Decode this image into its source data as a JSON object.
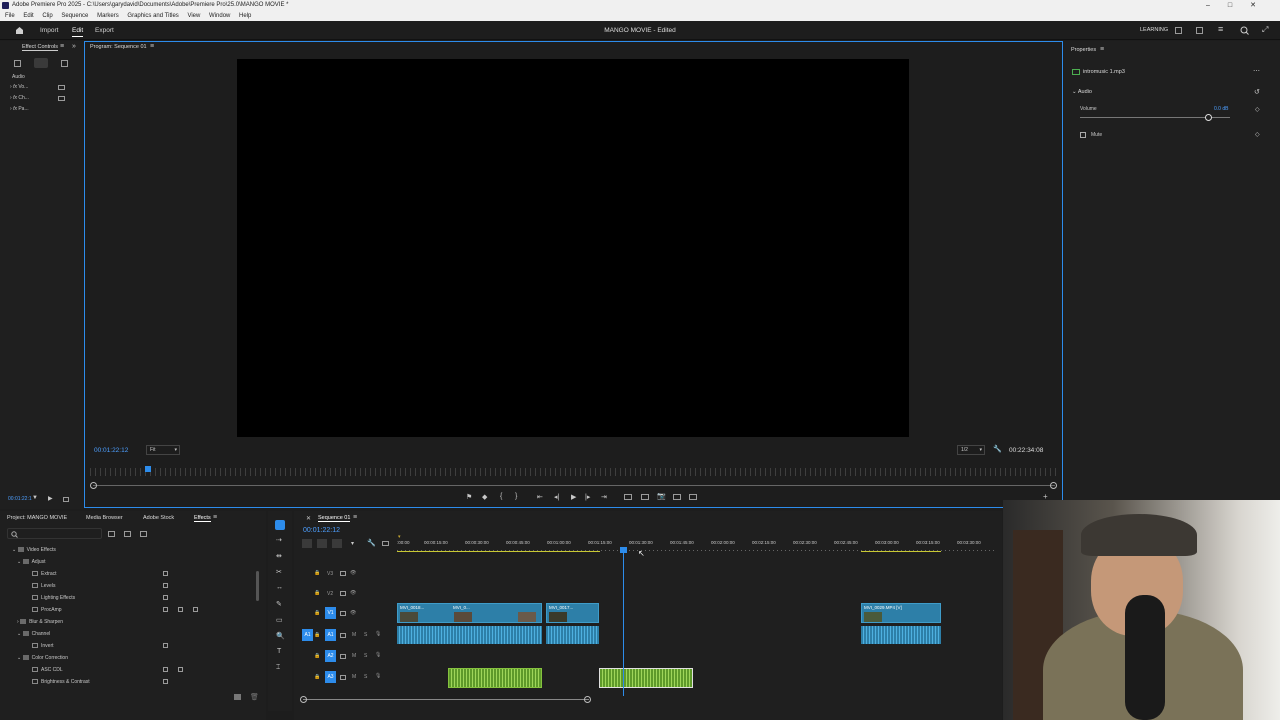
{
  "window": {
    "title": "Adobe Premiere Pro 2025 - C:\\Users\\garydavid\\Documents\\Adobe\\Premiere Pro\\25.0\\MANGO MOVIE *"
  },
  "menu": [
    "File",
    "Edit",
    "Clip",
    "Sequence",
    "Markers",
    "Graphics and Titles",
    "View",
    "Window",
    "Help"
  ],
  "header": {
    "tabs": [
      "Import",
      "Edit",
      "Export"
    ],
    "active_tab": "Edit",
    "project_title": "MANGO MOVIE - Edited",
    "workspace": "LEARNING"
  },
  "effect_controls": {
    "title": "Effect Controls",
    "section": "Audio",
    "rows": [
      "Vo...",
      "Ch...",
      "Pa..."
    ],
    "timecode": "00:01:22:1"
  },
  "program_monitor": {
    "title": "Program: Sequence 01",
    "timecode": "00:01:22:12",
    "fit": "Fit",
    "resolution": "1/2",
    "duration": "00:22:34:08"
  },
  "properties": {
    "title": "Properties",
    "clip_name": "intromusic 1.mp3",
    "section": "Audio",
    "volume_label": "Volume",
    "volume_value": "0.0 dB",
    "volume_level": 0.85,
    "mute_label": "Mute"
  },
  "project": {
    "tabs": [
      "Project: MANGO MOVIE",
      "Media Browser",
      "Adobe Stock",
      "Effects"
    ],
    "active_tab": "Effects",
    "tree": [
      {
        "label": "Video Effects",
        "level": 0,
        "type": "folder"
      },
      {
        "label": "Adjust",
        "level": 1,
        "type": "folder"
      },
      {
        "label": "Extract",
        "level": 2,
        "type": "effect"
      },
      {
        "label": "Levels",
        "level": 2,
        "type": "effect"
      },
      {
        "label": "Lighting Effects",
        "level": 2,
        "type": "effect"
      },
      {
        "label": "ProcAmp",
        "level": 2,
        "type": "effect"
      },
      {
        "label": "Blur & Sharpen",
        "level": 1,
        "type": "folder"
      },
      {
        "label": "Channel",
        "level": 1,
        "type": "folder"
      },
      {
        "label": "Invert",
        "level": 2,
        "type": "effect"
      },
      {
        "label": "Color Correction",
        "level": 1,
        "type": "folder"
      },
      {
        "label": "ASC CDL",
        "level": 2,
        "type": "effect"
      },
      {
        "label": "Brightness & Contrast",
        "level": 2,
        "type": "effect"
      }
    ]
  },
  "timeline": {
    "title": "Sequence 01",
    "timecode": "00:01:22:12",
    "ruler": [
      ":00:00",
      "00:00:15:00",
      "00:00:30:00",
      "00:00:45:00",
      "00:01:00:00",
      "00:01:15:00",
      "00:01:30:00",
      "00:01:45:00",
      "00:02:00:00",
      "00:02:15:00",
      "00:02:30:00",
      "00:02:45:00",
      "00:03:00:00",
      "00:03:15:00",
      "00:03:30:00"
    ],
    "tracks": [
      "V3",
      "V2",
      "V1",
      "A1",
      "A2",
      "A3"
    ],
    "clips": [
      {
        "label": "MVI_0018...",
        "track": "V1"
      },
      {
        "label": "MVI_0...",
        "track": "V1"
      },
      {
        "label": "MVI_0017...",
        "track": "V1"
      },
      {
        "label": "MVI_0029.MP4 [V]",
        "track": "V1"
      }
    ]
  },
  "colors": {
    "accent": "#2d8ceb",
    "video_clip": "#2d7fa8",
    "audio_music": "#5e9a2a",
    "playhead": "#2d8ceb"
  }
}
